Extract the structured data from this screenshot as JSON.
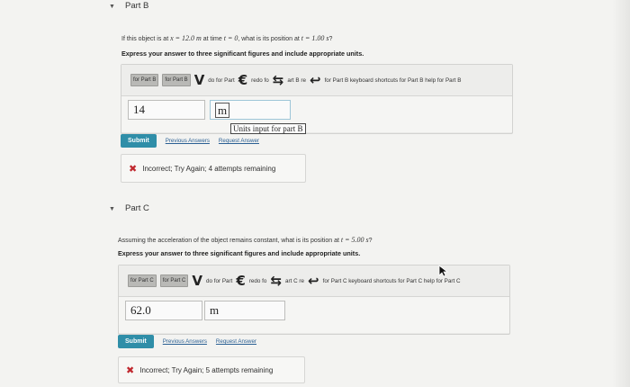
{
  "part_b": {
    "title": "Part B",
    "question_pre": "If this object is at ",
    "x_expr": "x = 12.0 m",
    "mid1": " at time ",
    "t_expr": "t = 0",
    "mid2": ", what is its position at ",
    "t2_expr": "t = 1.00 s",
    "question_end": "?",
    "instruction": "Express your answer to three significant figures and include appropriate units.",
    "toolbar": {
      "btn1": "for Part B",
      "btn2": "for Part B",
      "undo_glyph": "V",
      "undo_text": "do for Part",
      "redo_glyph": "€",
      "redo_text": "redo fo",
      "reset_glyph": "⇆",
      "reset_text": "art B re",
      "keyboard_glyph": "↩",
      "keyboard_text": "for Part B keyboard shortcuts for Part B help for Part B"
    },
    "value": "14",
    "unit": "m",
    "units_tooltip": "Units input for part B",
    "submit_label": "Submit",
    "previous_answers": "Previous Answers",
    "request_answer": "Request Answer",
    "feedback": "Incorrect; Try Again; 4 attempts remaining"
  },
  "part_c": {
    "title": "Part C",
    "question_pre": "Assuming the acceleration of the object remains constant, what is its position at ",
    "t_expr": "t = 5.00 s",
    "question_end": "?",
    "instruction": "Express your answer to three significant figures and include appropriate units.",
    "toolbar": {
      "btn1": "for Part C",
      "btn2": "for Part C",
      "undo_glyph": "V",
      "undo_text": "do for Part",
      "redo_glyph": "€",
      "redo_text": "redo fo",
      "reset_glyph": "⇆",
      "reset_text": "art C re",
      "keyboard_glyph": "↩",
      "keyboard_text": "for Part C keyboard shortcuts for Part C help for Part C"
    },
    "value": "62.0",
    "unit": "m",
    "submit_label": "Submit",
    "previous_answers": "Previous Answers",
    "request_answer": "Request Answer",
    "feedback": "Incorrect; Try Again; 5 attempts remaining"
  },
  "icons": {
    "collapse": "▼",
    "incorrect": "✖"
  },
  "colors": {
    "submit": "#2f8ea8",
    "link": "#2a5f93",
    "incorrect": "#c0282e"
  }
}
